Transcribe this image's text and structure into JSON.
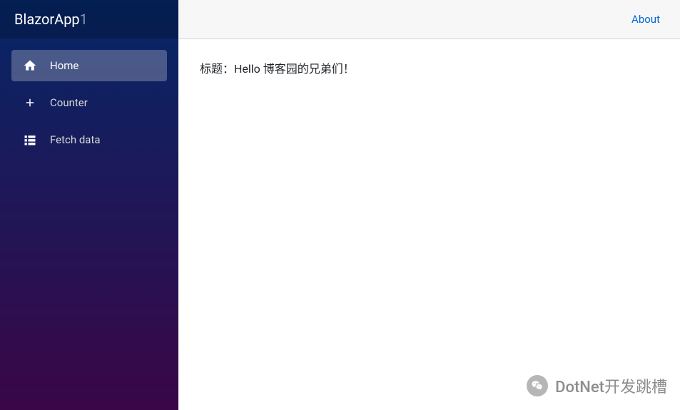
{
  "brand": {
    "name": "BlazorApp",
    "suffix": "1"
  },
  "sidebar": {
    "items": [
      {
        "label": "Home",
        "icon": "home-icon",
        "active": true
      },
      {
        "label": "Counter",
        "icon": "plus-icon",
        "active": false
      },
      {
        "label": "Fetch data",
        "icon": "list-icon",
        "active": false
      }
    ]
  },
  "topbar": {
    "about": "About"
  },
  "content": {
    "title": "标题：Hello 博客园的兄弟们！"
  },
  "watermark": {
    "text": "DotNet开发跳槽"
  }
}
